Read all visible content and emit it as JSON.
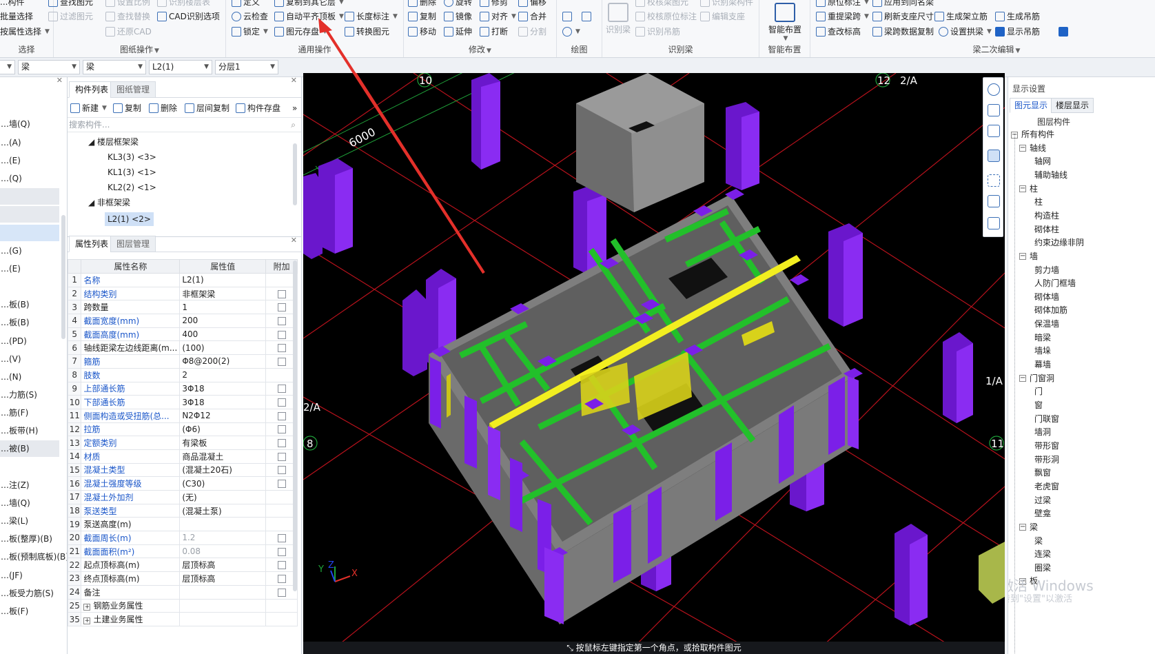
{
  "ribbon": {
    "groups": {
      "select": {
        "title": "选择",
        "items": [
          "...构件",
          "批量选择",
          "按属性选择"
        ]
      },
      "drawing_ops": {
        "title": "图纸操作",
        "items": [
          "查找图元",
          "过滤图元",
          "设置比例",
          "查找替换",
          "还原CAD",
          "识别楼层表",
          "CAD识别选项"
        ]
      },
      "general_ops": {
        "title": "通用操作",
        "items": [
          "定义",
          "云检查",
          "锁定",
          "复制到其它层",
          "自动平齐顶板",
          "图元存盘",
          "长度标注",
          "转换图元"
        ]
      },
      "modify": {
        "title": "修改",
        "items": [
          "删除",
          "旋转",
          "修剪",
          "偏移",
          "复制",
          "镜像",
          "对齐",
          "合并",
          "移动",
          "延伸",
          "打断",
          "分割"
        ]
      },
      "draw": {
        "title": "绘图"
      },
      "recognize": {
        "title": "识别梁",
        "items": [
          "识别梁",
          "校核梁图元",
          "校核原位标注",
          "识别吊筋",
          "识别梁构件",
          "编辑支座"
        ]
      },
      "smart_layout": {
        "title": "智能布置",
        "label": "智能布置"
      },
      "beam_edit": {
        "title": "梁二次编辑",
        "items": [
          "原位标注",
          "重提梁跨",
          "刷新支座尺寸",
          "生成架立筋",
          "生成吊筋",
          "查改标高",
          "梁跨数据复制",
          "设置拱梁",
          "显示吊筋",
          "应用到同名梁"
        ]
      }
    }
  },
  "filter": {
    "sel1": "梁",
    "sel2": "梁",
    "sel3": "L2(1)",
    "sel4": "分层1"
  },
  "leftnav": {
    "items": [
      "…墙(Q)",
      "…(A)",
      "…(E)",
      "…(Q)",
      "",
      "",
      "",
      "…(G)",
      "…(E)",
      "",
      "…板(B)",
      "…板(B)",
      "…(PD)",
      "…(V)",
      "…(N)",
      "…力筋(S)",
      "…筋(F)",
      "…板带(H)",
      "…被(B)",
      "",
      "…注(Z)",
      "…墙(Q)",
      "…梁(L)",
      "…板(整厚)(B)",
      "…板(预制底板)(B)",
      "…(JF)",
      "…板受力筋(S)",
      "…板(F)"
    ]
  },
  "complist": {
    "tab_active": "构件列表",
    "tab_inactive": "图纸管理",
    "tools": [
      "新建",
      "复制",
      "删除",
      "层间复制",
      "构件存盘"
    ],
    "search_placeholder": "搜索构件...",
    "groups": [
      {
        "name": "楼层框架梁",
        "items": [
          "KL3(3) <3>",
          "KL1(3) <1>",
          "KL2(2) <1>"
        ]
      },
      {
        "name": "非框架梁",
        "items": [
          "L2(1) <2>"
        ]
      }
    ]
  },
  "props": {
    "tab_active": "属性列表",
    "tab_inactive": "图层管理",
    "headers": [
      "属性名称",
      "属性值",
      "附加"
    ],
    "rows": [
      {
        "n": "1",
        "name": "名称",
        "val": "L2(1)",
        "blue": true,
        "chk": false
      },
      {
        "n": "2",
        "name": "结构类别",
        "val": "非框架梁",
        "blue": true,
        "chk": true
      },
      {
        "n": "3",
        "name": "跨数量",
        "val": "1",
        "blue": false,
        "chk": true
      },
      {
        "n": "4",
        "name": "截面宽度(mm)",
        "val": "200",
        "blue": true,
        "chk": true
      },
      {
        "n": "5",
        "name": "截面高度(mm)",
        "val": "400",
        "blue": true,
        "chk": true
      },
      {
        "n": "6",
        "name": "轴线距梁左边线距离(m...",
        "val": "(100)",
        "blue": false,
        "chk": true
      },
      {
        "n": "7",
        "name": "箍筋",
        "val": "Φ8@200(2)",
        "blue": true,
        "chk": true
      },
      {
        "n": "8",
        "name": "肢数",
        "val": "2",
        "blue": true,
        "chk": false
      },
      {
        "n": "9",
        "name": "上部通长筋",
        "val": "3Φ18",
        "blue": true,
        "chk": true
      },
      {
        "n": "10",
        "name": "下部通长筋",
        "val": "3Φ18",
        "blue": true,
        "chk": true
      },
      {
        "n": "11",
        "name": "侧面构造或受扭筋(总...",
        "val": "N2Φ12",
        "blue": true,
        "chk": true
      },
      {
        "n": "12",
        "name": "拉筋",
        "val": "(Φ6)",
        "blue": true,
        "chk": true
      },
      {
        "n": "13",
        "name": "定额类别",
        "val": "有梁板",
        "blue": true,
        "chk": true
      },
      {
        "n": "14",
        "name": "材质",
        "val": "商品混凝土",
        "blue": true,
        "chk": true
      },
      {
        "n": "15",
        "name": "混凝土类型",
        "val": "(混凝土20石)",
        "blue": true,
        "chk": true
      },
      {
        "n": "16",
        "name": "混凝土强度等级",
        "val": "(C30)",
        "blue": true,
        "chk": true
      },
      {
        "n": "17",
        "name": "混凝土外加剂",
        "val": "(无)",
        "blue": true,
        "chk": false
      },
      {
        "n": "18",
        "name": "泵送类型",
        "val": "(混凝土泵)",
        "blue": true,
        "chk": false
      },
      {
        "n": "19",
        "name": "泵送高度(m)",
        "val": "",
        "blue": false,
        "chk": false
      },
      {
        "n": "20",
        "name": "截面周长(m)",
        "val": "1.2",
        "blue": true,
        "chk": true,
        "gray": true
      },
      {
        "n": "21",
        "name": "截面面积(m²)",
        "val": "0.08",
        "blue": true,
        "chk": true,
        "gray": true
      },
      {
        "n": "22",
        "name": "起点顶标高(m)",
        "val": "层顶标高",
        "blue": false,
        "chk": true
      },
      {
        "n": "23",
        "name": "终点顶标高(m)",
        "val": "层顶标高",
        "blue": false,
        "chk": true
      },
      {
        "n": "24",
        "name": "备注",
        "val": "",
        "blue": false,
        "chk": true
      },
      {
        "n": "25",
        "name": "钢筋业务属性",
        "val": "",
        "blue": false,
        "chk": false,
        "expand": true
      },
      {
        "n": "35",
        "name": "土建业务属性",
        "val": "",
        "blue": false,
        "chk": false,
        "expand": true
      }
    ]
  },
  "viewport": {
    "axis_labels": {
      "a10": "10",
      "a12": "12",
      "a2a_top": "2/A",
      "a1a": "1/A",
      "a2a_left": "2/A",
      "a8": "8",
      "a11": "11",
      "a8b": "8"
    },
    "dimension": "6000",
    "status": "按鼠标左键指定第一个角点，或拾取构件图元",
    "axes": {
      "y": "Y",
      "z": "Z",
      "x": "X"
    },
    "colors": {
      "column": "#7b1fe8",
      "wall": "#7d7d7d",
      "beam": "#22c02a",
      "selected_beam": "#e6e21a",
      "grid": "#c8141e",
      "arrow": "#e3302a"
    }
  },
  "display": {
    "title": "显示设置",
    "tab_active": "图元显示",
    "tab_inactive": "楼层显示",
    "header": "图层构件",
    "tree": [
      {
        "label": "所有构件",
        "level": 0,
        "minus": true
      },
      {
        "label": "轴线",
        "level": 1,
        "minus": true
      },
      {
        "label": "轴网",
        "level": 2
      },
      {
        "label": "辅助轴线",
        "level": 2
      },
      {
        "label": "柱",
        "level": 1,
        "minus": true
      },
      {
        "label": "柱",
        "level": 2
      },
      {
        "label": "构造柱",
        "level": 2
      },
      {
        "label": "砌体柱",
        "level": 2
      },
      {
        "label": "约束边缘非阴",
        "level": 2
      },
      {
        "label": "墙",
        "level": 1,
        "minus": true
      },
      {
        "label": "剪力墙",
        "level": 2
      },
      {
        "label": "人防门框墙",
        "level": 2
      },
      {
        "label": "砌体墙",
        "level": 2
      },
      {
        "label": "砌体加筋",
        "level": 2
      },
      {
        "label": "保温墙",
        "level": 2
      },
      {
        "label": "暗梁",
        "level": 2
      },
      {
        "label": "墙垛",
        "level": 2
      },
      {
        "label": "幕墙",
        "level": 2
      },
      {
        "label": "门窗洞",
        "level": 1,
        "minus": true
      },
      {
        "label": "门",
        "level": 2
      },
      {
        "label": "窗",
        "level": 2
      },
      {
        "label": "门联窗",
        "level": 2
      },
      {
        "label": "墙洞",
        "level": 2
      },
      {
        "label": "带形窗",
        "level": 2
      },
      {
        "label": "带形洞",
        "level": 2
      },
      {
        "label": "飘窗",
        "level": 2
      },
      {
        "label": "老虎窗",
        "level": 2
      },
      {
        "label": "过梁",
        "level": 2
      },
      {
        "label": "壁龛",
        "level": 2
      },
      {
        "label": "梁",
        "level": 1,
        "minus": true
      },
      {
        "label": "梁",
        "level": 2
      },
      {
        "label": "连梁",
        "level": 2
      },
      {
        "label": "圈梁",
        "level": 2
      },
      {
        "label": "板",
        "level": 1,
        "minus": true
      }
    ],
    "watermark1": "激活 Windows",
    "watermark2": "转到\"设置\"以激活"
  }
}
